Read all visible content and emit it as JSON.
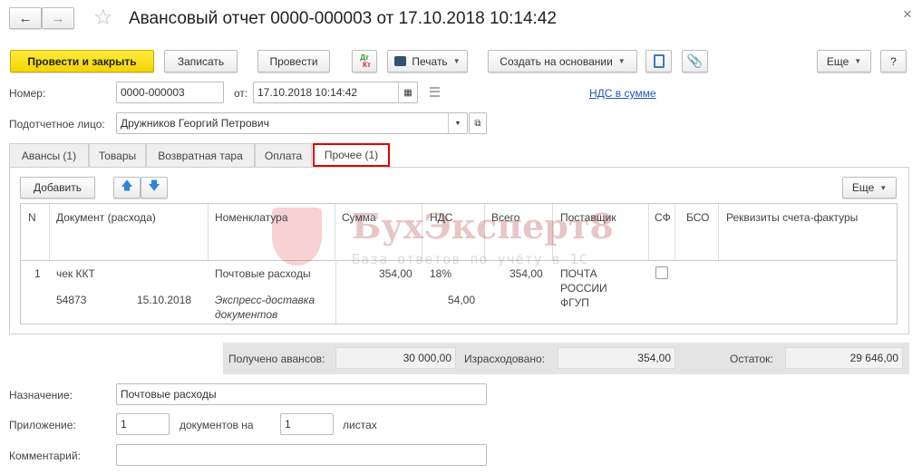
{
  "window": {
    "title": "Авансовый отчет 0000-000003 от 17.10.2018 10:14:42",
    "back_icon": "←",
    "forward_icon": "→",
    "close_icon": "×"
  },
  "toolbar": {
    "post_close": "Провести и закрыть",
    "save": "Записать",
    "post": "Провести",
    "dtkt_top": "Дт",
    "dtkt_bottom": "Кт",
    "print": "Печать",
    "create_based": "Создать на основании",
    "more": "Еще",
    "help": "?"
  },
  "header": {
    "number_label": "Номер:",
    "number": "0000-000003",
    "date_label": "от:",
    "date": "17.10.2018 10:14:42",
    "vat_link": "НДС в сумме",
    "person_label": "Подотчетное лицо:",
    "person": "Дружников Георгий Петрович"
  },
  "tabs": [
    {
      "label": "Авансы (1)"
    },
    {
      "label": "Товары"
    },
    {
      "label": "Возвратная тара"
    },
    {
      "label": "Оплата"
    },
    {
      "label": "Прочее (1)"
    }
  ],
  "table_toolbar": {
    "add": "Добавить",
    "more": "Еще"
  },
  "table": {
    "columns": [
      "N",
      "Документ (расхода)",
      "Номенклатура",
      "Сумма",
      "НДС",
      "Всего",
      "Поставщик",
      "СФ",
      "БСО",
      "Реквизиты счета-фактуры"
    ],
    "rows": [
      {
        "n": "1",
        "doc_type": "чек ККТ",
        "doc_number": "54873",
        "doc_date": "15.10.2018",
        "item": "Почтовые расходы",
        "item_comment_1": "Экспресс-доставка",
        "item_comment_2": "документов",
        "sum": "354,00",
        "vat_rate": "18%",
        "vat_sum": "54,00",
        "total": "354,00",
        "supplier_1": "ПОЧТА",
        "supplier_2": "РОССИИ",
        "supplier_3": "ФГУП",
        "sf_checked": false
      }
    ]
  },
  "watermark": {
    "brand": "БухЭксперт8",
    "tagline": "База ответов по учёту в 1С"
  },
  "totals": {
    "received_label": "Получено авансов:",
    "received": "30 000,00",
    "spent_label": "Израсходовано:",
    "spent": "354,00",
    "balance_label": "Остаток:",
    "balance": "29 646,00"
  },
  "footer": {
    "purpose_label": "Назначение:",
    "purpose": "Почтовые расходы",
    "attach_label": "Приложение:",
    "attach_docs": "1",
    "docs_on": "документов на",
    "attach_sheets": "1",
    "sheets": "листах",
    "comment_label": "Комментарий:",
    "comment": ""
  }
}
